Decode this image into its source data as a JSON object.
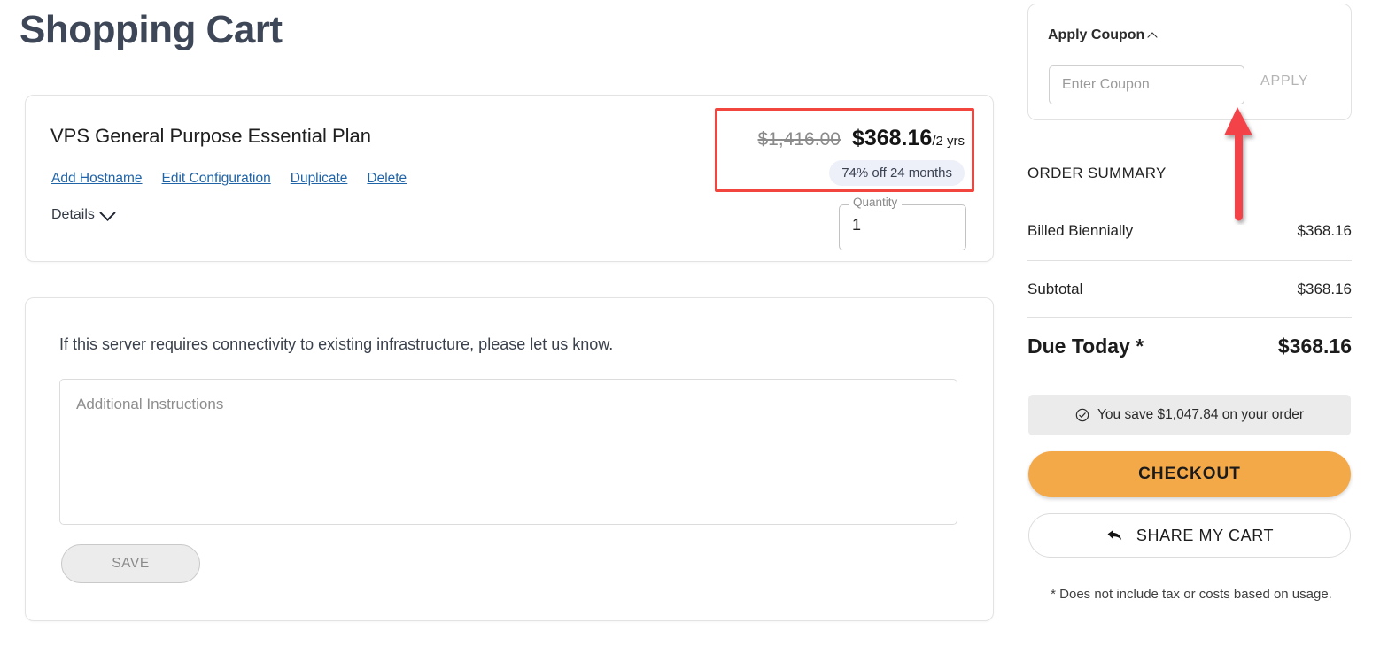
{
  "page": {
    "title": "Shopping Cart"
  },
  "product": {
    "name": "VPS General Purpose Essential Plan",
    "links": [
      {
        "label": "Add Hostname",
        "name": "add-hostname-link"
      },
      {
        "label": "Edit Configuration",
        "name": "edit-configuration-link"
      },
      {
        "label": "Duplicate",
        "name": "duplicate-link"
      },
      {
        "label": "Delete",
        "name": "delete-link"
      }
    ],
    "details_label": "Details",
    "price_original": "$1,416.00",
    "price_current": "$368.16",
    "price_term": "/2 yrs",
    "discount_badge": "74% off 24 months",
    "quantity_legend": "Quantity",
    "quantity_value": "1"
  },
  "instructions": {
    "note": "If this server requires connectivity to existing infrastructure, please let us know.",
    "textarea_placeholder": "Additional Instructions",
    "save_label": "SAVE"
  },
  "coupon": {
    "heading": "Apply Coupon",
    "input_placeholder": "Enter Coupon",
    "input_value": "",
    "apply_label": "APPLY"
  },
  "summary": {
    "heading": "ORDER SUMMARY",
    "rows": [
      {
        "label": "Billed Biennially",
        "value": "$368.16"
      },
      {
        "label": "Subtotal",
        "value": "$368.16"
      }
    ],
    "due_label": "Due Today *",
    "due_value": "$368.16",
    "savings_text": "You save $1,047.84 on your order",
    "checkout_label": "CHECKOUT",
    "share_label": "SHARE MY CART",
    "footnote": "* Does not include tax or costs based on usage."
  },
  "annotation": {
    "arrow_color": "#f4434a",
    "highlight_color": "#f1453d"
  },
  "colors": {
    "link": "#2064a8",
    "checkout": "#f4a949",
    "badge_bg": "#edf0f9",
    "savings_bg": "#ebebeb",
    "title": "#3d4757"
  }
}
